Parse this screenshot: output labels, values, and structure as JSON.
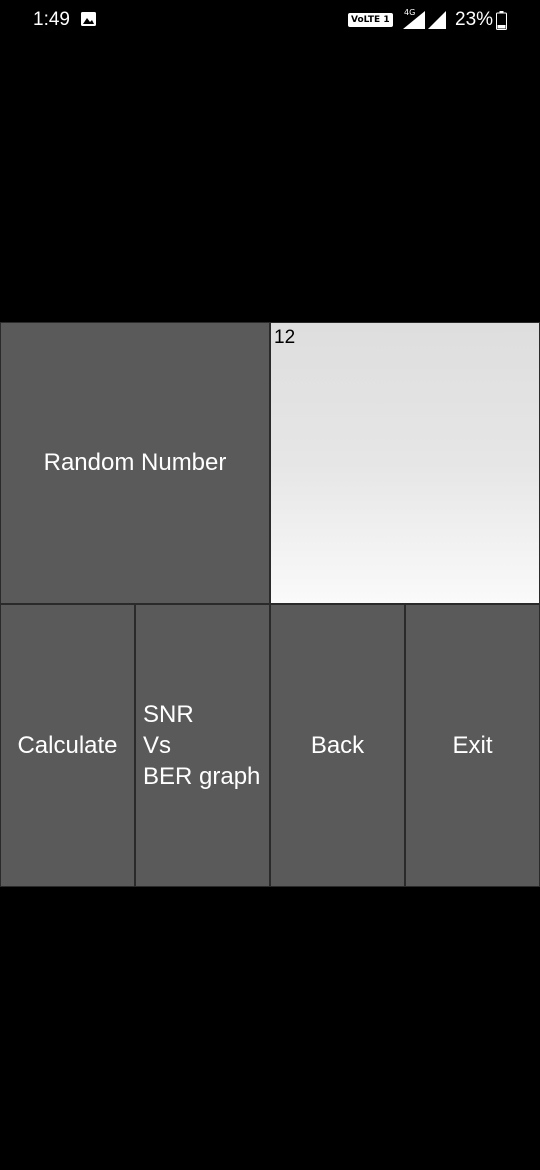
{
  "status_bar": {
    "time": "1:49",
    "network_badge": "VoLTE 1",
    "network_type": "4G",
    "battery_percent": "23%",
    "icons": [
      "gallery-icon",
      "signal-icon",
      "signal-icon",
      "battery-icon"
    ]
  },
  "buttons": {
    "random_number": "Random Number",
    "calculate": "Calculate",
    "snr_graph_lines": [
      "SNR",
      "Vs",
      "BER graph"
    ],
    "back": "Back",
    "exit": "Exit"
  },
  "display": {
    "value": "12"
  },
  "colors": {
    "background": "#000000",
    "button": "#5a5a5a",
    "button_text": "#ffffff",
    "display_top": "#dedede",
    "display_bottom": "#fafafa"
  }
}
